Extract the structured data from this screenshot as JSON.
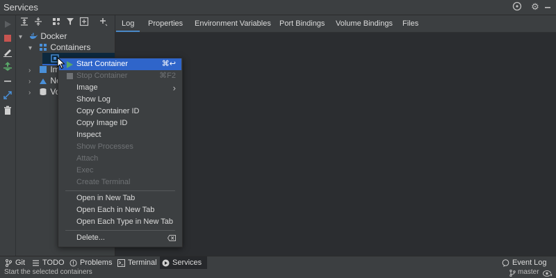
{
  "window": {
    "title": "Services"
  },
  "tree": {
    "docker": "Docker",
    "containers": "Containers",
    "images_partial": "Im",
    "networks_partial": "Ne",
    "volumes_partial": "Vo"
  },
  "tabs": [
    "Log",
    "Properties",
    "Environment Variables",
    "Port Bindings",
    "Volume Bindings",
    "Files"
  ],
  "context_menu": {
    "start_container": {
      "label": "Start Container",
      "shortcut": "⌘↩"
    },
    "stop_container": {
      "label": "Stop Container",
      "shortcut": "⌘F2"
    },
    "image": "Image",
    "show_log": "Show Log",
    "copy_container_id": "Copy Container ID",
    "copy_image_id": "Copy Image ID",
    "inspect": "Inspect",
    "show_processes": "Show Processes",
    "attach": "Attach",
    "exec": "Exec",
    "create_terminal": "Create Terminal",
    "open_in_new_tab": "Open in New Tab",
    "open_each_in_new_tab": "Open Each in New Tab",
    "open_each_type_in_new_tab": "Open Each Type in New Tab",
    "delete": "Delete..."
  },
  "bottom_tabs": {
    "git": "Git",
    "todo": "TODO",
    "problems": "Problems",
    "terminal": "Terminal",
    "services": "Services",
    "event_log": "Event Log",
    "branch": "master"
  },
  "status": {
    "text": "Start the selected containers"
  },
  "colors": {
    "accent": "#2f65ca",
    "run_green": "#59a869",
    "stop_red": "#c75450",
    "docker_blue": "#4a90d9"
  }
}
